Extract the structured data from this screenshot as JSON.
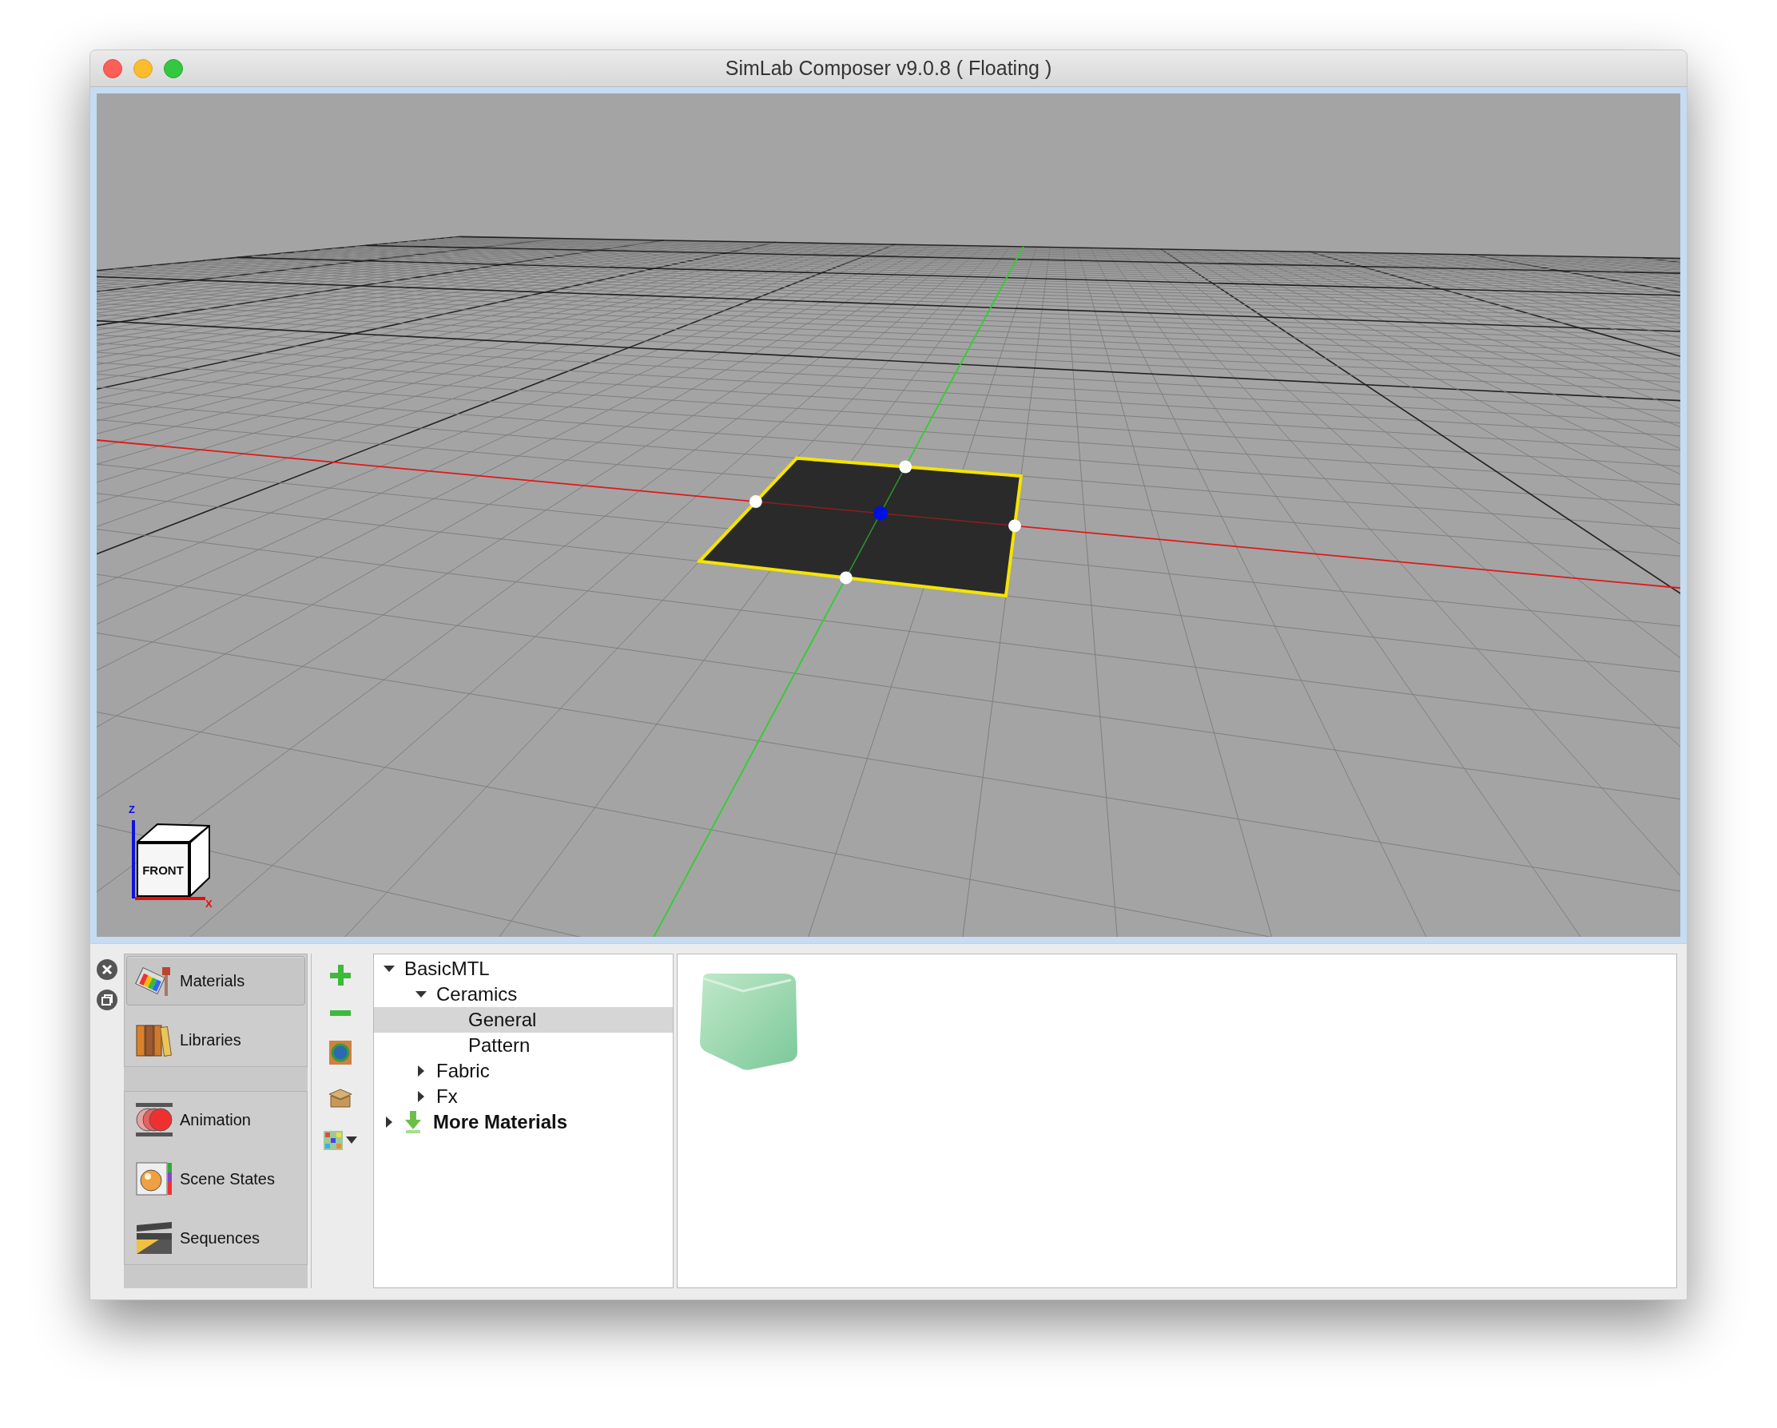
{
  "window": {
    "title": "SimLab Composer v9.0.8 ( Floating )"
  },
  "viewport": {
    "view_cube": {
      "face_label": "FRONT",
      "z_label": "Z",
      "x_label": "X"
    }
  },
  "sidebar": {
    "groups": [
      {
        "items": [
          {
            "label": "Materials",
            "selected": true
          },
          {
            "label": "Libraries",
            "selected": false
          }
        ]
      },
      {
        "items": [
          {
            "label": "Animation",
            "selected": false
          },
          {
            "label": "Scene States",
            "selected": false
          },
          {
            "label": "Sequences",
            "selected": false
          }
        ]
      }
    ]
  },
  "tree": {
    "items": [
      {
        "label": "BasicMTL",
        "kind": "category",
        "expanded": true,
        "selected": false,
        "children": [
          {
            "label": "Ceramics",
            "expanded": true,
            "selected": false,
            "children": [
              {
                "label": "General",
                "selected": true
              },
              {
                "label": "Pattern",
                "selected": false
              }
            ]
          },
          {
            "label": "Fabric",
            "expanded": false,
            "selected": false
          },
          {
            "label": "Fx",
            "expanded": false,
            "selected": false
          }
        ]
      },
      {
        "label": "More Materials",
        "kind": "download",
        "expanded": false,
        "selected": false
      }
    ]
  }
}
